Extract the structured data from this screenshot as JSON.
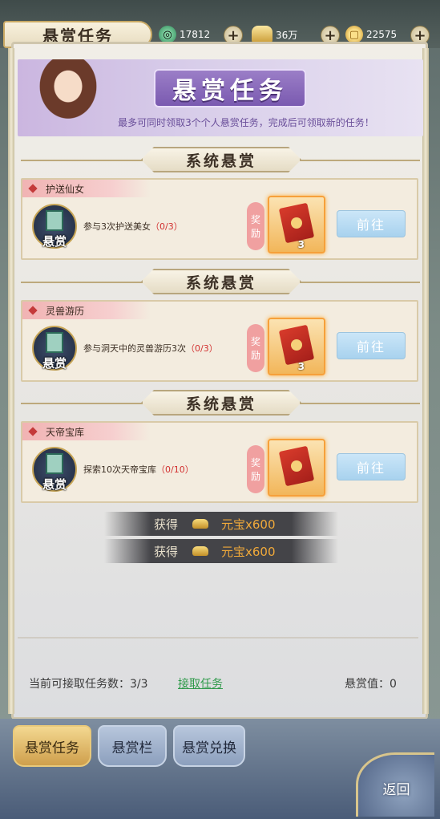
{
  "header": {
    "title": "悬赏任务",
    "resources": [
      {
        "icon": "jade-icon",
        "value": "17812"
      },
      {
        "icon": "silver-ingot-icon",
        "value": "36万"
      },
      {
        "icon": "coin-icon",
        "value": "22575"
      }
    ]
  },
  "banner": {
    "title": "悬赏任务",
    "note": "最多可同时领取3个个人悬赏任务，完成后可领取新的任务！"
  },
  "tasks": [
    {
      "section": "系统悬赏",
      "name": "护送仙女",
      "badge": "悬赏",
      "desc": "参与3次护送美女",
      "progress": "（0/3）",
      "reward_label": [
        "奖",
        "励"
      ],
      "reward_count": "3",
      "button": "前往"
    },
    {
      "section": "系统悬赏",
      "name": "灵兽游历",
      "badge": "悬赏",
      "desc": "参与洞天中的灵兽游历3次",
      "progress": "（0/3）",
      "reward_label": [
        "奖",
        "励"
      ],
      "reward_count": "3",
      "button": "前往"
    },
    {
      "section": "系统悬赏",
      "name": "天帝宝库",
      "badge": "悬赏",
      "desc": "探索10次天帝宝库",
      "progress": "（0/10）",
      "reward_label": [
        "奖",
        "励"
      ],
      "reward_count": "",
      "button": "前往"
    }
  ],
  "gains": [
    {
      "label": "获得",
      "item": "元宝x600"
    },
    {
      "label": "获得",
      "item": "元宝x600"
    }
  ],
  "footer": {
    "available": "当前可接取任务数：3/3",
    "accept_link": "接取任务",
    "bounty_value": "悬赏值：0"
  },
  "tabs": [
    {
      "label": "悬赏任务",
      "active": true
    },
    {
      "label": "悬赏栏",
      "active": false
    },
    {
      "label": "悬赏兑换",
      "active": false
    }
  ],
  "back_button": "返回"
}
